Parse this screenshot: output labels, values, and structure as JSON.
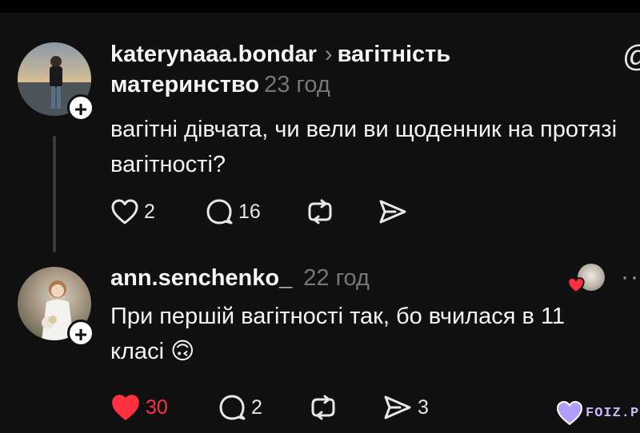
{
  "post1": {
    "username": "katerynaaa.bondar",
    "separator": "›",
    "community_line1": "вагітність",
    "community_line2": "материнство",
    "timestamp": "23 год",
    "text": "вагітні дівчата, чи вели ви щоденник на протязі вагітності?",
    "likes": "2",
    "replies": "16",
    "mention_icon": "@"
  },
  "post2": {
    "username": "ann.senchenko_",
    "timestamp": "22 год",
    "text_line1": "При першій вагітності так, бо вчилася в 11",
    "text_line2": "класі",
    "emoji": "🙃",
    "likes": "30",
    "replies": "2",
    "shares": "3",
    "liked": true,
    "more": "··"
  },
  "watermark": {
    "text": "FOIZ.PRO"
  },
  "colors": {
    "background": "#101010",
    "text": "#f3f5f7",
    "secondary": "#777777",
    "like_red": "#ff3040"
  }
}
